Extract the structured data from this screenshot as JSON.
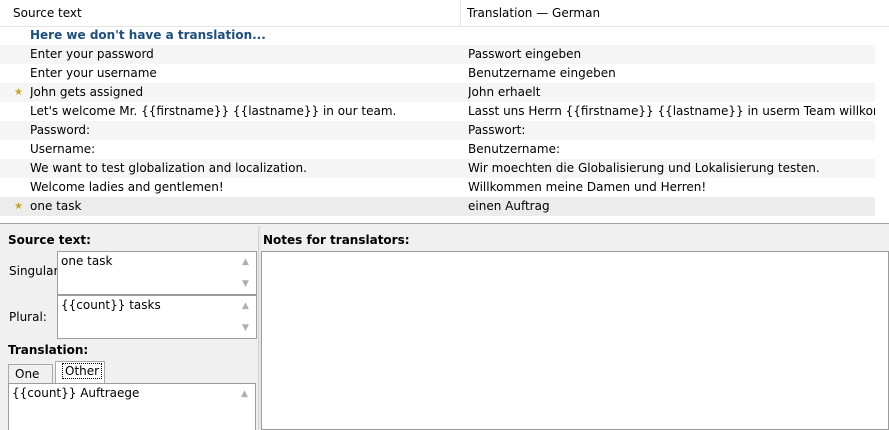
{
  "list": {
    "header": {
      "source": "Source text",
      "translation": "Translation — German"
    },
    "rows": [
      {
        "source": "Here we don't have a translation...",
        "translation": "",
        "starred": false,
        "group": true
      },
      {
        "source": "Enter your password",
        "translation": "Passwort eingeben",
        "starred": false
      },
      {
        "source": "Enter your username",
        "translation": "Benutzername eingeben",
        "starred": false
      },
      {
        "source": "John gets assigned",
        "translation": "John erhaelt",
        "starred": true
      },
      {
        "source": "Let's welcome Mr. {{firstname}} {{lastname}} in our team.",
        "translation": "Lasst uns Herrn {{firstname}} {{lastname}} in userm Team willkommen heissen.",
        "starred": false
      },
      {
        "source": "Password:",
        "translation": "Passwort:",
        "starred": false
      },
      {
        "source": "Username:",
        "translation": "Benutzername:",
        "starred": false
      },
      {
        "source": "We want to test globalization and localization.",
        "translation": "Wir moechten die Globalisierung und Lokalisierung testen.",
        "starred": false
      },
      {
        "source": "Welcome ladies and gentlemen!",
        "translation": "Willkommen meine Damen und Herren!",
        "starred": false
      },
      {
        "source": "one task",
        "translation": "einen Auftrag",
        "starred": true,
        "selected": true
      }
    ],
    "star_icon": "star-icon",
    "star_color": "#c9a227"
  },
  "source_panel": {
    "title": "Source text:",
    "singular_label": "Singular:",
    "singular_value": "one task",
    "plural_label": "Plural:",
    "plural_value": "{{count}} tasks"
  },
  "translation_panel": {
    "title": "Translation:",
    "tabs": [
      "One",
      "Other"
    ],
    "active_tab": "Other",
    "value": "{{count}} Auftraege"
  },
  "notes_panel": {
    "title": "Notes for translators:",
    "value": ""
  },
  "colors": {
    "group_text": "#1f4e79",
    "selected_row": "#ececec"
  }
}
